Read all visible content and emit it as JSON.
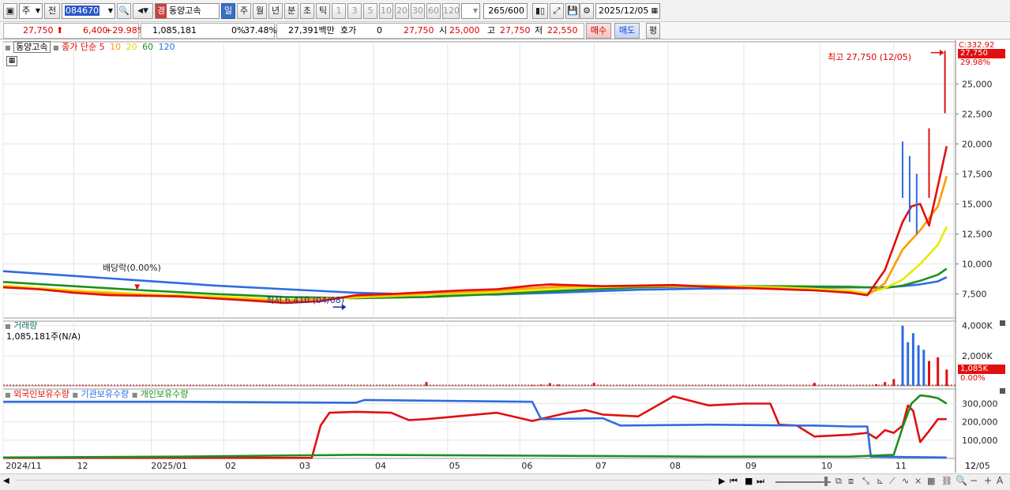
{
  "toolbar": {
    "period_select": "주",
    "prev_label": "전",
    "stock_code": "084670",
    "search_tag": "경",
    "stock_name": "동양고속",
    "tabs": [
      "일",
      "주",
      "월",
      "년",
      "분",
      "초",
      "틱"
    ],
    "selected_tab": "일",
    "intervals": [
      "1",
      "3",
      "5",
      "10",
      "20",
      "30",
      "60",
      "120"
    ],
    "count_current": "265",
    "count_total": "/600",
    "date": "2025/12/05"
  },
  "quote": {
    "price": "27,750",
    "arrow": "⬆",
    "change": "6,400",
    "change_pct": "+29.98%",
    "volume": "1,085,181",
    "ratio1": "0%",
    "ratio2": "37.48%",
    "amount": "27,391백만",
    "hoga_label": "호가",
    "hoga_value": "0",
    "hoga_price": "27,750",
    "open_label": "시",
    "open_value": "25,000",
    "high_label": "고",
    "high_value": "27,750",
    "low_label": "저",
    "low_value": "22,550",
    "buy_button": "매수",
    "sell_button": "매도",
    "eval_button": "평"
  },
  "price_pane": {
    "name_tag": "동양고속",
    "ma_label": "종가 단순",
    "ma_periods": [
      "5",
      "10",
      "20",
      "60",
      "120"
    ],
    "ma_colors": [
      "#e01010",
      "#ff9a00",
      "#e8e800",
      "#1e8e1e",
      "#2f6be0"
    ],
    "annot_high": "최고 27,750 (12/05)",
    "annot_low": "최저 6,410 (04/08)",
    "annot_dividend": "배당락(0.00%)",
    "right_box_c": "C:332.92",
    "right_box_price": "27,750",
    "right_box_pct": "29.98%"
  },
  "volume_pane": {
    "title": "거래량",
    "summary": "1,085,181주(N/A)",
    "last_box": "1,085K",
    "last_pct": "0.00%"
  },
  "holding_pane": {
    "legend": [
      "외국인보유수량",
      "기관보유수량",
      "개인보유수량"
    ],
    "legend_colors": [
      "#e01010",
      "#2f6be0",
      "#1e8e1e"
    ]
  },
  "x_axis": [
    "2024/11",
    "12",
    "2025/01",
    "02",
    "03",
    "04",
    "05",
    "06",
    "07",
    "08",
    "09",
    "10",
    "11",
    "12",
    "12/05"
  ],
  "chart_data": [
    {
      "type": "line",
      "title": "",
      "ylim": [
        5500,
        28500
      ],
      "y_ticks": [
        "25,000",
        "22,500",
        "20,000",
        "17,500",
        "15,000",
        "12,500",
        "10,000",
        "7,500"
      ],
      "x_domain": [
        0,
        54
      ],
      "series": [
        {
          "name": "5",
          "color": "#e01010",
          "points": [
            [
              0,
              8050
            ],
            [
              2,
              7900
            ],
            [
              4,
              7600
            ],
            [
              6,
              7400
            ],
            [
              8,
              7350
            ],
            [
              10,
              7300
            ],
            [
              14,
              6950
            ],
            [
              16,
              6750
            ],
            [
              18,
              6900
            ],
            [
              20,
              7400
            ],
            [
              22,
              7500
            ],
            [
              24,
              7650
            ],
            [
              26,
              7800
            ],
            [
              28,
              7900
            ],
            [
              30,
              8200
            ],
            [
              31,
              8300
            ],
            [
              32,
              8250
            ],
            [
              34,
              8150
            ],
            [
              36,
              8200
            ],
            [
              38,
              8250
            ],
            [
              40,
              8100
            ],
            [
              44,
              7900
            ],
            [
              46,
              7800
            ],
            [
              48,
              7600
            ],
            [
              49,
              7400
            ],
            [
              50,
              9500
            ],
            [
              50.5,
              11500
            ],
            [
              51,
              13500
            ],
            [
              51.5,
              14800
            ],
            [
              52,
              15000
            ],
            [
              52.5,
              13200
            ],
            [
              53,
              16500
            ],
            [
              53.5,
              19800
            ]
          ]
        },
        {
          "name": "10",
          "color": "#ff9a00",
          "points": [
            [
              0,
              8100
            ],
            [
              4,
              7700
            ],
            [
              8,
              7400
            ],
            [
              12,
              7150
            ],
            [
              16,
              6900
            ],
            [
              20,
              7300
            ],
            [
              24,
              7550
            ],
            [
              28,
              7800
            ],
            [
              30,
              8000
            ],
            [
              32,
              8150
            ],
            [
              36,
              8150
            ],
            [
              40,
              8150
            ],
            [
              44,
              7950
            ],
            [
              48,
              7650
            ],
            [
              49,
              7400
            ],
            [
              50,
              8400
            ],
            [
              50.5,
              9800
            ],
            [
              51,
              11200
            ],
            [
              52,
              12800
            ],
            [
              53,
              14800
            ],
            [
              53.5,
              17300
            ]
          ]
        },
        {
          "name": "20",
          "color": "#e8e800",
          "points": [
            [
              0,
              8200
            ],
            [
              4,
              7800
            ],
            [
              8,
              7500
            ],
            [
              12,
              7300
            ],
            [
              16,
              7000
            ],
            [
              20,
              7200
            ],
            [
              24,
              7450
            ],
            [
              28,
              7650
            ],
            [
              32,
              8000
            ],
            [
              36,
              8150
            ],
            [
              40,
              8200
            ],
            [
              44,
              8050
            ],
            [
              48,
              7800
            ],
            [
              49,
              7550
            ],
            [
              50,
              8000
            ],
            [
              51,
              8700
            ],
            [
              52,
              10000
            ],
            [
              53,
              11600
            ],
            [
              53.5,
              13100
            ]
          ]
        },
        {
          "name": "60",
          "color": "#1e8e1e",
          "points": [
            [
              0,
              8500
            ],
            [
              4,
              8150
            ],
            [
              8,
              7800
            ],
            [
              12,
              7500
            ],
            [
              16,
              7250
            ],
            [
              20,
              7150
            ],
            [
              24,
              7250
            ],
            [
              28,
              7500
            ],
            [
              32,
              7800
            ],
            [
              36,
              8050
            ],
            [
              40,
              8150
            ],
            [
              44,
              8150
            ],
            [
              48,
              8100
            ],
            [
              50,
              8000
            ],
            [
              51,
              8200
            ],
            [
              52,
              8600
            ],
            [
              53,
              9100
            ],
            [
              53.5,
              9600
            ]
          ]
        },
        {
          "name": "120",
          "color": "#2f6be0",
          "points": [
            [
              0,
              9400
            ],
            [
              4,
              9000
            ],
            [
              8,
              8600
            ],
            [
              12,
              8200
            ],
            [
              16,
              7900
            ],
            [
              20,
              7600
            ],
            [
              24,
              7450
            ],
            [
              28,
              7450
            ],
            [
              32,
              7650
            ],
            [
              36,
              7850
            ],
            [
              40,
              7950
            ],
            [
              44,
              8000
            ],
            [
              48,
              8050
            ],
            [
              50,
              8050
            ],
            [
              51,
              8150
            ],
            [
              52,
              8300
            ],
            [
              53,
              8550
            ],
            [
              53.5,
              8900
            ]
          ]
        }
      ]
    },
    {
      "type": "bar",
      "title": "거래량",
      "ylim": [
        0,
        4300000
      ],
      "y_ticks": [
        "4,000K",
        "2,000K"
      ],
      "values": [
        [
          24,
          250000
        ],
        [
          30,
          60000
        ],
        [
          30.5,
          90000
        ],
        [
          31,
          180000
        ],
        [
          31.5,
          90000
        ],
        [
          33.5,
          200000
        ],
        [
          46,
          200000
        ],
        [
          49.5,
          110000
        ],
        [
          50,
          250000
        ],
        [
          50.5,
          450000
        ],
        [
          51,
          4000000
        ],
        [
          51.3,
          2900000
        ],
        [
          51.6,
          3500000
        ],
        [
          51.9,
          2700000
        ],
        [
          52.2,
          2400000
        ],
        [
          52.5,
          1650000
        ],
        [
          53,
          1900000
        ],
        [
          53.5,
          1085181
        ]
      ]
    },
    {
      "type": "line",
      "title": "보유수량",
      "ylim": [
        0,
        380000
      ],
      "y_ticks": [
        "300,000",
        "200,000",
        "100,000"
      ],
      "series": [
        {
          "name": "외국인보유수량",
          "color": "#e01010",
          "points": [
            [
              0,
              3000
            ],
            [
              17.5,
              3000
            ],
            [
              18,
              180000
            ],
            [
              18.5,
              250000
            ],
            [
              20,
              255000
            ],
            [
              22,
              250000
            ],
            [
              23,
              210000
            ],
            [
              24,
              215000
            ],
            [
              28,
              250000
            ],
            [
              30,
              205000
            ],
            [
              32,
              250000
            ],
            [
              33,
              265000
            ],
            [
              34,
              240000
            ],
            [
              36,
              230000
            ],
            [
              38,
              340000
            ],
            [
              40,
              290000
            ],
            [
              42,
              300000
            ],
            [
              43.5,
              300000
            ],
            [
              44,
              185000
            ],
            [
              45,
              180000
            ],
            [
              46,
              120000
            ],
            [
              48,
              130000
            ],
            [
              49,
              140000
            ],
            [
              49.5,
              110000
            ],
            [
              50,
              155000
            ],
            [
              50.5,
              140000
            ],
            [
              51,
              180000
            ],
            [
              51.3,
              290000
            ],
            [
              51.6,
              260000
            ],
            [
              52,
              90000
            ],
            [
              52.5,
              150000
            ],
            [
              53,
              215000
            ],
            [
              53.5,
              215000
            ]
          ]
        },
        {
          "name": "기관보유수량",
          "color": "#2f6be0",
          "points": [
            [
              0,
              310000
            ],
            [
              10,
              310000
            ],
            [
              20,
              305000
            ],
            [
              20.5,
              320000
            ],
            [
              30,
              310000
            ],
            [
              30.5,
              215000
            ],
            [
              34,
              220000
            ],
            [
              35,
              180000
            ],
            [
              40,
              185000
            ],
            [
              45,
              180000
            ],
            [
              46,
              180000
            ],
            [
              48,
              175000
            ],
            [
              49,
              175000
            ],
            [
              49.2,
              10000
            ],
            [
              53.5,
              5000
            ]
          ]
        },
        {
          "name": "개인보유수량",
          "color": "#1e8e1e",
          "points": [
            [
              0,
              5000
            ],
            [
              10,
              10000
            ],
            [
              20,
              20000
            ],
            [
              30,
              15000
            ],
            [
              40,
              10000
            ],
            [
              48,
              10000
            ],
            [
              50.5,
              20000
            ],
            [
              51,
              170000
            ],
            [
              51.5,
              300000
            ],
            [
              52,
              345000
            ],
            [
              52.5,
              340000
            ],
            [
              53,
              330000
            ],
            [
              53.5,
              300000
            ]
          ]
        }
      ]
    }
  ]
}
